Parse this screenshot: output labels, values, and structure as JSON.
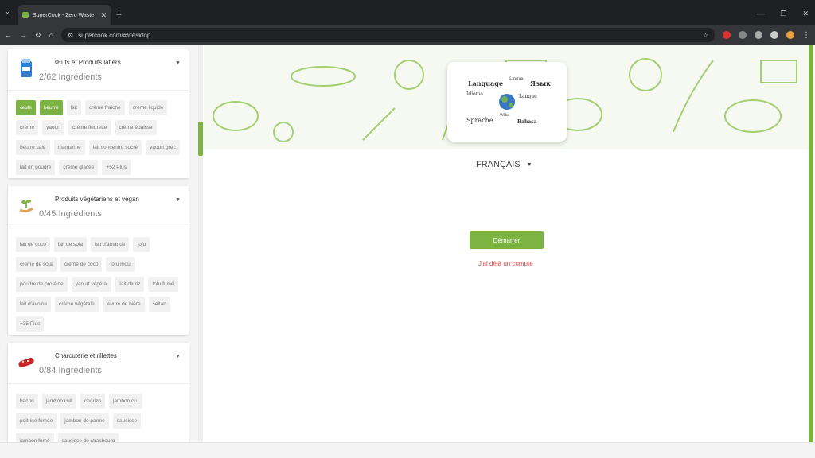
{
  "browser": {
    "tab_title": "SuperCook - Zero Waste Recipe",
    "url": "supercook.com/#/desktop"
  },
  "sidebar": {
    "categories": [
      {
        "title": "Œufs et Produits latiers",
        "count": "2/62 Ingrédients",
        "icon": "milk-carton-icon",
        "chips": [
          {
            "label": "œufs",
            "selected": true
          },
          {
            "label": "beurre",
            "selected": true
          },
          {
            "label": "lait",
            "selected": false
          },
          {
            "label": "crème fraîche",
            "selected": false
          },
          {
            "label": "crème liquide",
            "selected": false
          },
          {
            "label": "crème",
            "selected": false
          },
          {
            "label": "yaourt",
            "selected": false
          },
          {
            "label": "crème fleurette",
            "selected": false
          },
          {
            "label": "crème épaisse",
            "selected": false
          },
          {
            "label": "beurre salé",
            "selected": false
          },
          {
            "label": "margarine",
            "selected": false
          },
          {
            "label": "lait concentré sucré",
            "selected": false
          },
          {
            "label": "yaourt grec",
            "selected": false
          },
          {
            "label": "lait en poudre",
            "selected": false
          },
          {
            "label": "crème glacée",
            "selected": false
          },
          {
            "label": "+52 Plus",
            "selected": false
          }
        ]
      },
      {
        "title": "Produits végétariens et végan",
        "count": "0/45 Ingrédients",
        "icon": "plant-hand-icon",
        "chips": [
          {
            "label": "lait de coco",
            "selected": false
          },
          {
            "label": "lait de soja",
            "selected": false
          },
          {
            "label": "lait d'amande",
            "selected": false
          },
          {
            "label": "tofu",
            "selected": false
          },
          {
            "label": "crème de soja",
            "selected": false
          },
          {
            "label": "crème de coco",
            "selected": false
          },
          {
            "label": "tofu mou",
            "selected": false
          },
          {
            "label": "poudre de protéine",
            "selected": false
          },
          {
            "label": "yaourt végétal",
            "selected": false
          },
          {
            "label": "lait de riz",
            "selected": false
          },
          {
            "label": "tofu fumé",
            "selected": false
          },
          {
            "label": "lait d'avoine",
            "selected": false
          },
          {
            "label": "crème végétale",
            "selected": false
          },
          {
            "label": "levure de bière",
            "selected": false
          },
          {
            "label": "seitan",
            "selected": false
          },
          {
            "label": "+35 Plus",
            "selected": false
          }
        ]
      },
      {
        "title": "Charcuterie et rillettes",
        "count": "0/84 Ingrédients",
        "icon": "sausage-icon",
        "chips": [
          {
            "label": "bacon",
            "selected": false
          },
          {
            "label": "jambon cuit",
            "selected": false
          },
          {
            "label": "chorizo",
            "selected": false
          },
          {
            "label": "jambon cru",
            "selected": false
          },
          {
            "label": "poitrine fumée",
            "selected": false
          },
          {
            "label": "jambon de parme",
            "selected": false
          },
          {
            "label": "saucisse",
            "selected": false
          },
          {
            "label": "jambon fumé",
            "selected": false
          },
          {
            "label": "saucisse de strasbourg",
            "selected": false
          }
        ]
      }
    ]
  },
  "main": {
    "language": "FRANÇAIS",
    "start_label": "Démarrer",
    "account_label": "J'ai déjà un compte",
    "lang_words": [
      "Language",
      "Язык",
      "Lingua",
      "Idioma",
      "Sprache",
      "Langue",
      "Bahasa",
      "Wika"
    ]
  },
  "colors": {
    "accent": "#7cb342",
    "link": "#d64545"
  }
}
